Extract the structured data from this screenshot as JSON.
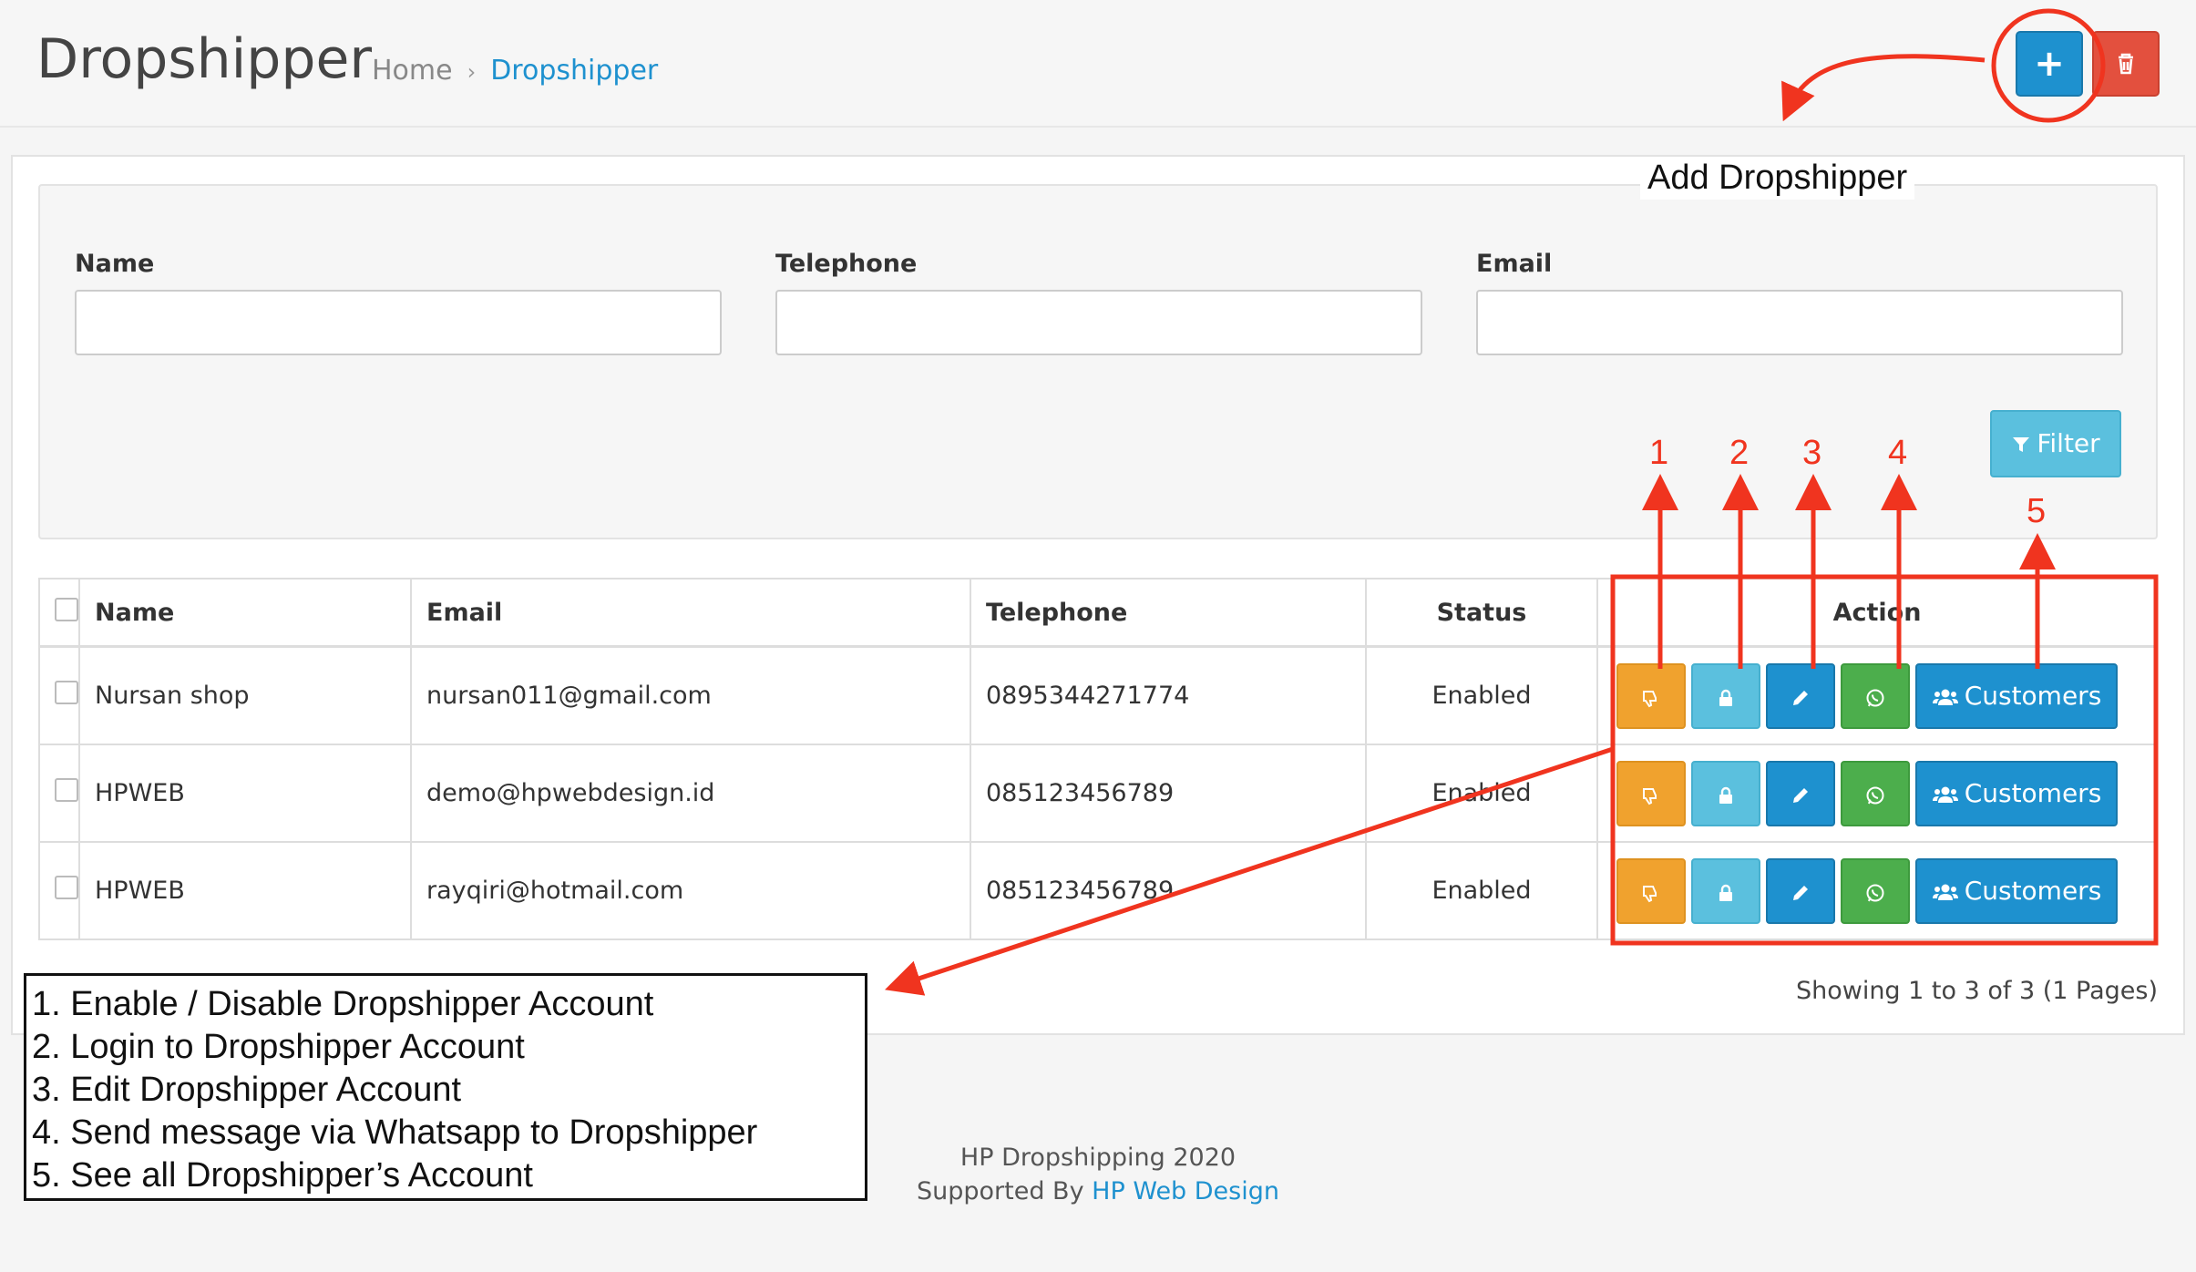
{
  "header": {
    "title": "Dropshipper",
    "breadcrumb": [
      "Home",
      "Dropshipper"
    ],
    "add_icon": "plus-icon",
    "delete_icon": "trash-icon"
  },
  "filter": {
    "fields": [
      {
        "label": "Name",
        "value": ""
      },
      {
        "label": "Telephone",
        "value": ""
      },
      {
        "label": "Email",
        "value": ""
      }
    ],
    "button_label": "Filter",
    "button_icon": "funnel-icon"
  },
  "table": {
    "columns": [
      "Name",
      "Email",
      "Telephone",
      "Status",
      "Action"
    ],
    "rows": [
      {
        "name": "Nursan shop",
        "email": "nursan011@gmail.com",
        "telephone": "0895344271774",
        "status": "Enabled"
      },
      {
        "name": "HPWEB",
        "email": "demo@hpwebdesign.id",
        "telephone": "085123456789",
        "status": "Enabled"
      },
      {
        "name": "HPWEB",
        "email": "rayqiri@hotmail.com",
        "telephone": "085123456789",
        "status": "Enabled"
      }
    ],
    "action_icons": [
      "thumbs-down-icon",
      "lock-icon",
      "pencil-icon",
      "whatsapp-icon"
    ],
    "customers_label": "Customers",
    "customers_icon": "users-icon"
  },
  "pagination": {
    "info": "Showing 1 to 3 of 3 (1 Pages)"
  },
  "footer": {
    "line1": "HP Dropshipping 2020",
    "line2_prefix": "Supported By",
    "link": "HP Web Design"
  },
  "annotations": {
    "add_label": "Add Dropshipper",
    "numbers": [
      "1",
      "2",
      "3",
      "4",
      "5"
    ],
    "legend": [
      "1. Enable / Disable Dropshipper Account",
      "2. Login to Dropshipper Account",
      "3. Edit Dropshipper Account",
      "4. Send message via Whatsapp to Dropshipper",
      "5. See all Dropshipper’s Account"
    ],
    "color": "#f0341f"
  },
  "colors": {
    "primary": "#1e91cf",
    "danger": "#e3503e",
    "warning": "#f0a22e",
    "info": "#5bc0de",
    "success": "#4cae4c"
  }
}
